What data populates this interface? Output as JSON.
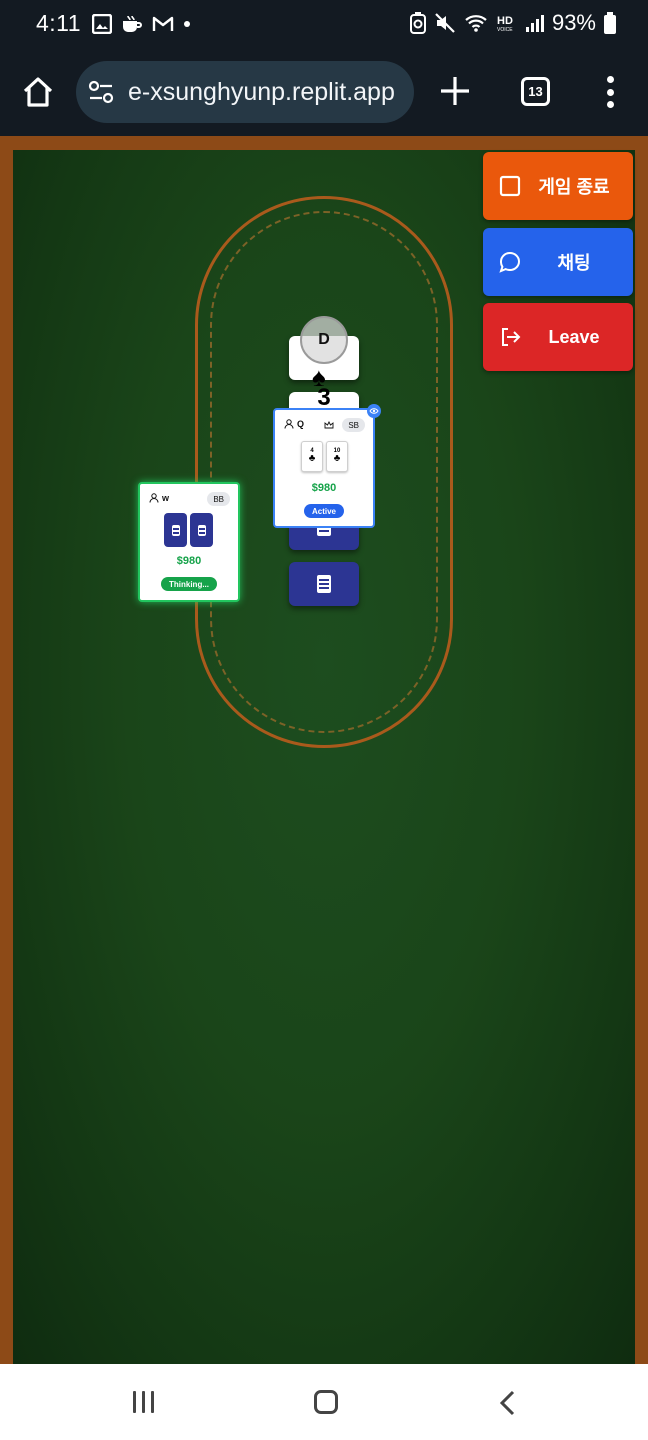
{
  "status_bar": {
    "time": "4:11",
    "battery": "93%"
  },
  "browser": {
    "url": "e-xsunghyunp.replit.app",
    "tab_count": "13"
  },
  "game": {
    "actions": [
      {
        "label": "게임 종료",
        "icon": "square-icon",
        "color": "#ea580c"
      },
      {
        "label": "채팅",
        "icon": "chat-bubble-icon",
        "color": "#2563eb"
      },
      {
        "label": "Leave",
        "icon": "logout-icon",
        "color": "#dc2626"
      }
    ],
    "dealer_label": "D",
    "community": {
      "rank": "3",
      "suit": "♠"
    },
    "players": [
      {
        "name": "w",
        "position": "BB",
        "money": "$980",
        "status": "Thinking...",
        "status_color": "#16a34a"
      },
      {
        "name": "Q",
        "position": "SB",
        "money": "$980",
        "status": "Active",
        "status_color": "#2563eb",
        "cards": [
          {
            "rank": "4",
            "suit": "♣"
          },
          {
            "rank": "10",
            "suit": "♣"
          }
        ]
      }
    ]
  }
}
